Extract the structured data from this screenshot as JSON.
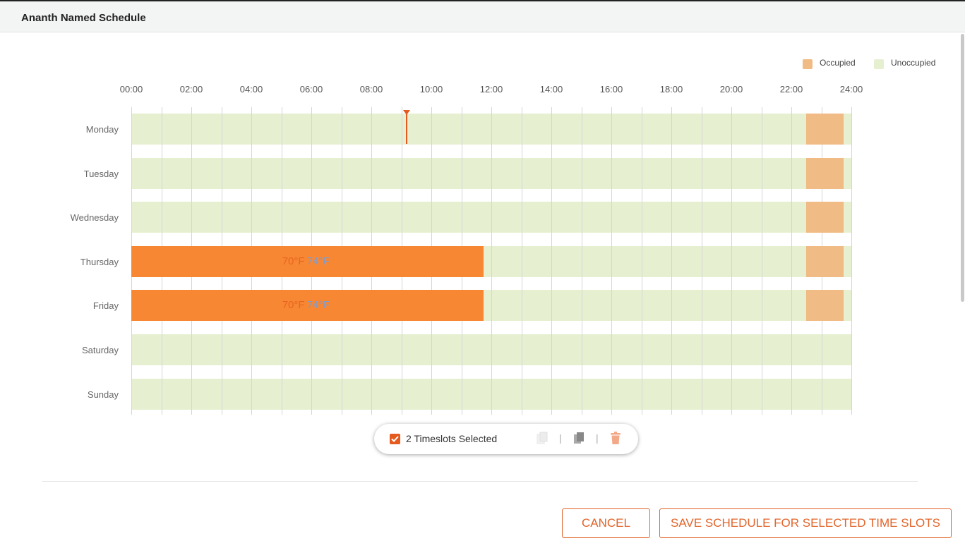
{
  "header": {
    "title": "Ananth Named Schedule"
  },
  "legend": [
    {
      "label": "Occupied",
      "color": "#f0bb84"
    },
    {
      "label": "Unoccupied",
      "color": "#e6f0d0"
    }
  ],
  "hours": [
    "00:00",
    "02:00",
    "04:00",
    "06:00",
    "08:00",
    "10:00",
    "12:00",
    "14:00",
    "16:00",
    "18:00",
    "20:00",
    "22:00",
    "24:00"
  ],
  "days": [
    "Monday",
    "Tuesday",
    "Wednesday",
    "Thursday",
    "Friday",
    "Saturday",
    "Sunday"
  ],
  "schedule": {
    "current_time": "09:10",
    "occupied_slots": [
      {
        "day": "Monday",
        "start": "22:30",
        "end": "23:45"
      },
      {
        "day": "Tuesday",
        "start": "22:30",
        "end": "23:45"
      },
      {
        "day": "Wednesday",
        "start": "22:30",
        "end": "23:45"
      },
      {
        "day": "Thursday",
        "start": "22:30",
        "end": "23:45"
      },
      {
        "day": "Friday",
        "start": "22:30",
        "end": "23:45"
      }
    ],
    "selected_slots": [
      {
        "day": "Thursday",
        "start": "00:00",
        "end": "11:45",
        "low_temp": "70°F",
        "high_temp": "74°F"
      },
      {
        "day": "Friday",
        "start": "00:00",
        "end": "11:45",
        "low_temp": "70°F",
        "high_temp": "74°F"
      }
    ]
  },
  "selection_toolbar": {
    "checked": true,
    "label": "2 Timeslots Selected",
    "separator": "|",
    "icons": [
      "copy-disabled-icon",
      "paste-icon",
      "trash-icon"
    ]
  },
  "footer": {
    "cancel_label": "CANCEL",
    "save_label": "SAVE SCHEDULE FOR SELECTED TIME SLOTS"
  },
  "colors": {
    "accent": "#e2642a",
    "selected": "#f78733",
    "occupied": "#f0bb84",
    "unoccupied": "#e6f0d0"
  }
}
